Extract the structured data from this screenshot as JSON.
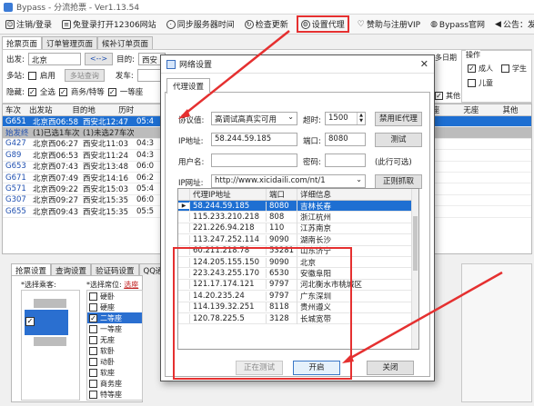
{
  "app": {
    "title": "Bypass - 分流抢票 - Ver1.13.54"
  },
  "toolbar": {
    "items": [
      {
        "label": "注销/登录",
        "icon": "user-icon"
      },
      {
        "label": "免登录打开12306网站",
        "icon": "document-icon"
      },
      {
        "label": "同步服务器时间",
        "icon": "clock-icon"
      },
      {
        "label": "检查更新",
        "icon": "refresh-icon"
      },
      {
        "label": "设置代理",
        "icon": "gear-icon"
      },
      {
        "label": "赞助与注册VIP",
        "icon": "heart-icon"
      },
      {
        "label": "Bypass官网",
        "icon": "globe-icon"
      },
      {
        "label": "公告：发车前一周才是抢票高峰",
        "icon": "speaker-icon"
      }
    ]
  },
  "main_tabs": [
    "抢票页面",
    "订单管理页面",
    "候补订单页面"
  ],
  "query": {
    "from_label": "出发:",
    "from_value": "北京",
    "swap_label": "<-->",
    "to_label": "目的:",
    "to_value": "西安",
    "multi_label": "多站:",
    "multi_enabled_label": "启用",
    "multi_query_btn": "多站查询",
    "depart_label": "发车:",
    "hide_label": "隐藏:",
    "hide_all": "全选",
    "hide_business": "商务/特等",
    "hide_first": "一等座"
  },
  "right_group": {
    "legend": "操作",
    "date_suffix": "多日期",
    "adult": "成人",
    "student": "学生",
    "child": "儿童",
    "other1": "其他",
    "other2": "其他"
  },
  "train_grid": {
    "headers": [
      "车次",
      "出发站",
      "目的地",
      "历时"
    ],
    "extra_headers": [
      "硬座",
      "无座",
      "其他"
    ],
    "rows": [
      {
        "train": "G651",
        "from": "北京西06:58",
        "to": "西安北12:47",
        "dur": "05:4",
        "state": "selected"
      },
      {
        "train": "始发终",
        "from": "(1)已选1车次",
        "to": "(1)未选27车次",
        "dur": "",
        "state": "stop"
      },
      {
        "train": "G427",
        "from": "北京西06:27",
        "to": "西安北11:03",
        "dur": "04:3",
        "state": ""
      },
      {
        "train": "G89",
        "from": "北京西06:53",
        "to": "西安北11:24",
        "dur": "04:3",
        "state": ""
      },
      {
        "train": "G653",
        "from": "北京西07:43",
        "to": "西安北13:48",
        "dur": "06:0",
        "state": ""
      },
      {
        "train": "G671",
        "from": "北京西07:49",
        "to": "西安北14:16",
        "dur": "06:2",
        "state": ""
      },
      {
        "train": "G571",
        "from": "北京西09:22",
        "to": "西安北15:03",
        "dur": "05:4",
        "state": ""
      },
      {
        "train": "G307",
        "from": "北京西09:27",
        "to": "西安北15:35",
        "dur": "06:0",
        "state": ""
      },
      {
        "train": "G655",
        "from": "北京西09:43",
        "to": "西安北15:35",
        "dur": "05:5",
        "state": ""
      }
    ]
  },
  "bottom_tabs": [
    "抢票设置",
    "查询设置",
    "验证码设置",
    "QQ通知"
  ],
  "bottom_panel": {
    "passenger_label": "*选择乘客:",
    "seat_label": "*选择席位:",
    "seat_pick": "选座",
    "seats": [
      {
        "name": "硬卧",
        "checked": false,
        "sel": false
      },
      {
        "name": "硬座",
        "checked": false,
        "sel": false
      },
      {
        "name": "二等座",
        "checked": true,
        "sel": true
      },
      {
        "name": "一等座",
        "checked": false,
        "sel": false
      },
      {
        "name": "无座",
        "checked": false,
        "sel": false
      },
      {
        "name": "软卧",
        "checked": false,
        "sel": false
      },
      {
        "name": "动卧",
        "checked": false,
        "sel": false
      },
      {
        "name": "软座",
        "checked": false,
        "sel": false
      },
      {
        "name": "商务座",
        "checked": false,
        "sel": false
      },
      {
        "name": "特等座",
        "checked": false,
        "sel": false
      }
    ]
  },
  "dialog": {
    "title": "网络设置",
    "close": "✕",
    "tab": "代理设置",
    "protocol_label": "协议值:",
    "protocol_value": "高调试高真实可用",
    "timeout_label": "超时:",
    "timeout_value": "1500",
    "disable_ie_btn": "禁用IE代理",
    "ip_label": "IP地址:",
    "ip_value": "58.244.59.185",
    "port_label": "端口:",
    "port_value": "8080",
    "test_btn": "测试",
    "user_label": "用户名:",
    "pass_label": "密码:",
    "optional_note": "(此行可选)",
    "ipsite_label": "IP网址:",
    "ipsite_value": "http://www.xicidaili.com/nt/1",
    "fetch_btn": "正则抓取",
    "table_headers": [
      "代理IP地址",
      "端口",
      "详细信息"
    ],
    "proxies": [
      {
        "ip": "58.244.59.185",
        "port": "8080",
        "info": "吉林长春"
      },
      {
        "ip": "115.233.210.218",
        "port": "808",
        "info": "浙江杭州"
      },
      {
        "ip": "221.226.94.218",
        "port": "110",
        "info": "江苏南京"
      },
      {
        "ip": "113.247.252.114",
        "port": "9090",
        "info": "湖南长沙"
      },
      {
        "ip": "60.211.218.78",
        "port": "53281",
        "info": "山东济宁"
      },
      {
        "ip": "124.205.155.150",
        "port": "9090",
        "info": "北京"
      },
      {
        "ip": "223.243.255.170",
        "port": "6530",
        "info": "安徽阜阳"
      },
      {
        "ip": "121.17.174.121",
        "port": "9797",
        "info": "河北衡水市桃城区"
      },
      {
        "ip": "14.20.235.24",
        "port": "9797",
        "info": "广东深圳"
      },
      {
        "ip": "114.139.32.251",
        "port": "8118",
        "info": "贵州遵义"
      },
      {
        "ip": "120.78.225.5",
        "port": "3128",
        "info": "长城宽带"
      }
    ],
    "testing_btn": "正在测试",
    "start_btn": "开启",
    "close_btn": "关闭"
  },
  "colors": {
    "selection": "#1e6fd2",
    "annotation": "#e53030"
  }
}
